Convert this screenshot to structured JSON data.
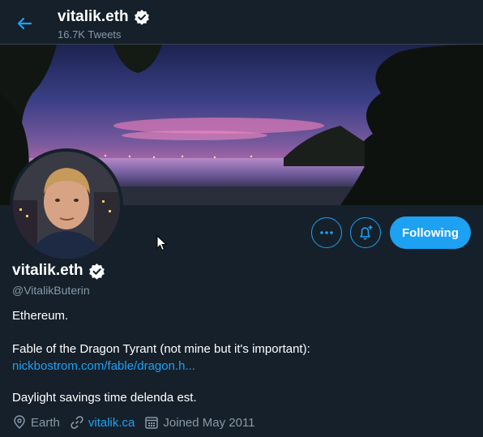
{
  "header": {
    "title": "vitalik.eth",
    "tweets_count": "16.7K Tweets"
  },
  "profile": {
    "display_name": "vitalik.eth",
    "handle": "@VitalikButerin",
    "bio_line1": "Ethereum.",
    "bio_line2": "Fable of the Dragon Tyrant (not mine but it's important):",
    "bio_link": "nickbostrom.com/fable/dragon.h...",
    "bio_line3": "Daylight savings time delenda est.",
    "location": "Earth",
    "website": "vitalik.ca",
    "joined": "Joined May 2011"
  },
  "actions": {
    "following_label": "Following"
  },
  "colors": {
    "background": "#15202b",
    "accent": "#1da1f2",
    "secondary_text": "#8899a6"
  },
  "icons": [
    "back-arrow-icon",
    "verified-badge-icon",
    "more-icon",
    "notification-bell-plus-icon",
    "location-pin-icon",
    "link-icon",
    "calendar-icon"
  ]
}
